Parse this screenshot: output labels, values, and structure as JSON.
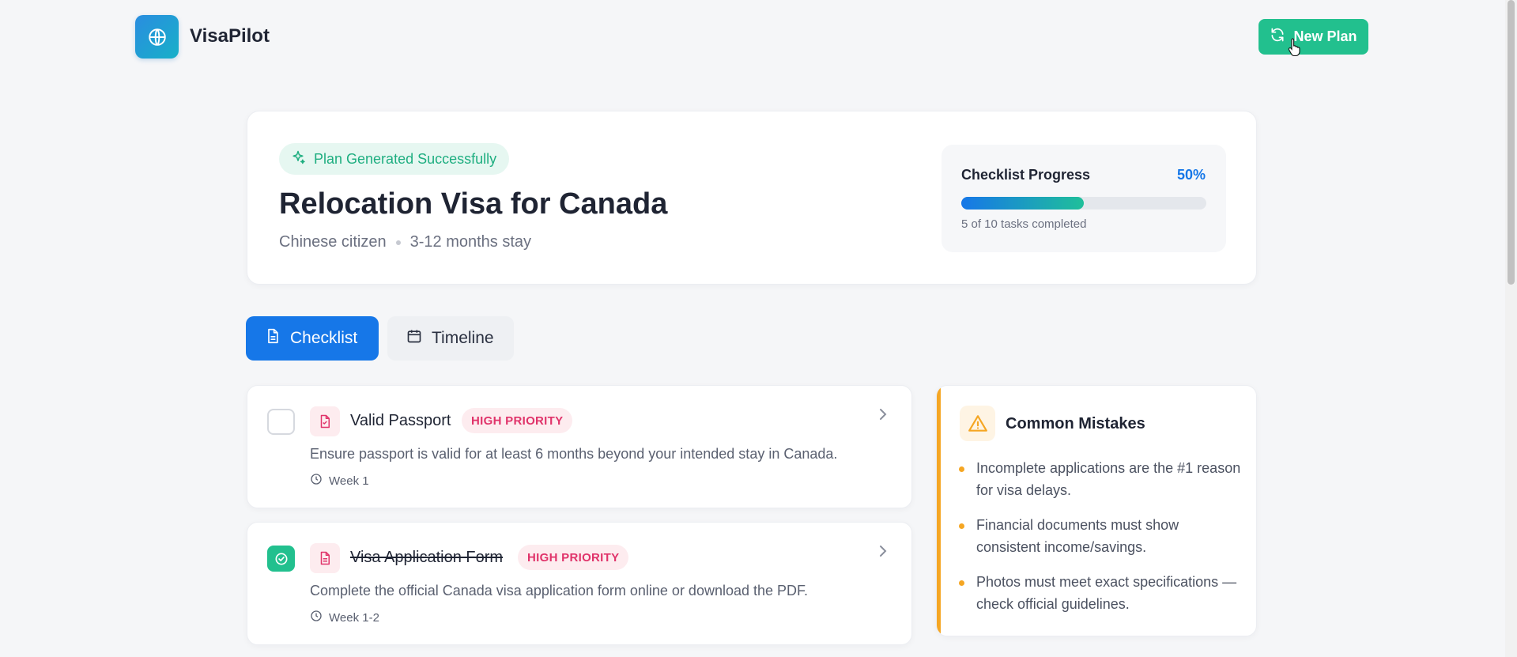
{
  "header": {
    "brand": "VisaPilot",
    "new_plan_label": "New Plan",
    "accent_color": "#22c08e"
  },
  "hero": {
    "badge": "Plan Generated Successfully",
    "title": "Relocation Visa for Canada",
    "citizenship": "Chinese citizen",
    "stay": "3-12 months stay"
  },
  "progress": {
    "title": "Checklist Progress",
    "percent_label": "50%",
    "fraction": 0.5,
    "note": "5 of 10 tasks completed"
  },
  "tabs": [
    {
      "label": "Checklist",
      "active": true
    },
    {
      "label": "Timeline",
      "active": false
    }
  ],
  "tasks": [
    {
      "title": "Valid Passport",
      "priority": "HIGH PRIORITY",
      "description": "Ensure passport is valid for at least 6 months beyond your intended stay in Canada.",
      "week": "Week 1",
      "completed": false
    },
    {
      "title": "Visa Application Form",
      "priority": "HIGH PRIORITY",
      "description": "Complete the official Canada visa application form online or download the PDF.",
      "week": "Week 1-2",
      "completed": true
    }
  ],
  "mistakes": {
    "title": "Common Mistakes",
    "items": [
      "Incomplete applications are the #1 reason for visa delays.",
      "Financial documents must show consistent income/savings.",
      "Photos must meet exact specifications — check official guidelines."
    ]
  }
}
